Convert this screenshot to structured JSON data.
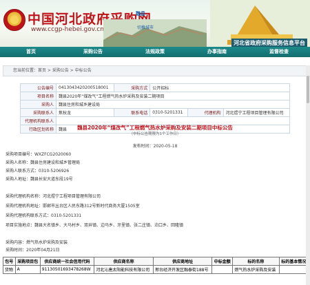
{
  "header": {
    "site_title": "中国河北政府采购网",
    "site_url": "www.ccgp-hebei.gov.cn",
    "city_tag": "魏县",
    "city_switch": "切换城市",
    "platform_name": "河北省政府采购服务信息平台"
  },
  "nav": {
    "items": [
      "首页",
      "采购公告",
      "法规政策",
      "办事指南",
      "监督检查"
    ]
  },
  "breadcrumb": {
    "label": "您当前位置：",
    "path": "首页 > 采购公告 > 中标公告"
  },
  "info": {
    "rows": [
      {
        "k1": "公告编号",
        "v1": "0413043420200518001",
        "k2": "采购方式",
        "v2": "公开招标",
        "k3": "",
        "v3": ""
      },
      {
        "k1": "项目名称",
        "v1": "魏县2020年“煤改气”工程燃气热水炉采购及安装二期项目",
        "k2": "",
        "v2": "",
        "k3": "",
        "v3": ""
      },
      {
        "k1": "采购人",
        "v1": "魏县住房和城乡建设局",
        "k2": "",
        "v2": "",
        "k3": "",
        "v3": ""
      },
      {
        "k1": "采购联系人",
        "v1": "焦秋龙",
        "k2": "联系电话",
        "v2": "0310-5201331",
        "k3": "代理机构",
        "v3": "河北煜宁工程项目管理有限公司"
      },
      {
        "k1": "代理机构联系人",
        "v1": "",
        "k2": "",
        "v2": "",
        "k3": "",
        "v3": ""
      },
      {
        "k1": "行政区划名称",
        "v1": "魏县",
        "k2": "",
        "v2": "",
        "k3": "",
        "v3": ""
      }
    ]
  },
  "announcement": {
    "title": "魏县2020年“煤改气”工程燃气热水炉采购及安装二期项目中标公告",
    "subtitle": "（中标公告期限为1个工作日）",
    "date": "发布时间：2020-05-18",
    "lines": [
      "采购项目编号：WXZFCG2020060",
      "采购人名称：魏县住房建设和城乡管理局",
      "采购人联系方式：0310-5206926",
      "采购人地址：魏县长安大道东段19号",
      "采购代理机构名称：河北煜宁工程项目管理有限公司",
      "采购代理机构地址：邯郸市丛台区人民东路312号新时代商务大厦1505室",
      "采购代理机构联系方式：0310-5201331",
      "项目实施地点：魏县大名镇乡、大马村乡、双井镇、边马乡、牙里镇、张二庄镇、泊口乡、回隆镇",
      "采购内容：燃气热水炉采购及安装",
      "采购时间：2020年04月21日",
      "采购公告：采购"
    ]
  },
  "result_table": {
    "headers": [
      "包号",
      "采购项目包",
      "供应商统一社会信用代码",
      "供应商名称",
      "供应商地址",
      "中标金额",
      "标的名称",
      "标的基本情况"
    ],
    "rows": [
      [
        "货物",
        "A",
        "911305016934782​68W",
        "河北沁唐太阳能科技有限公司",
        "邢台经济开发区融泰街188号",
        "",
        "燃气热水炉采购及安装",
        ""
      ]
    ]
  }
}
